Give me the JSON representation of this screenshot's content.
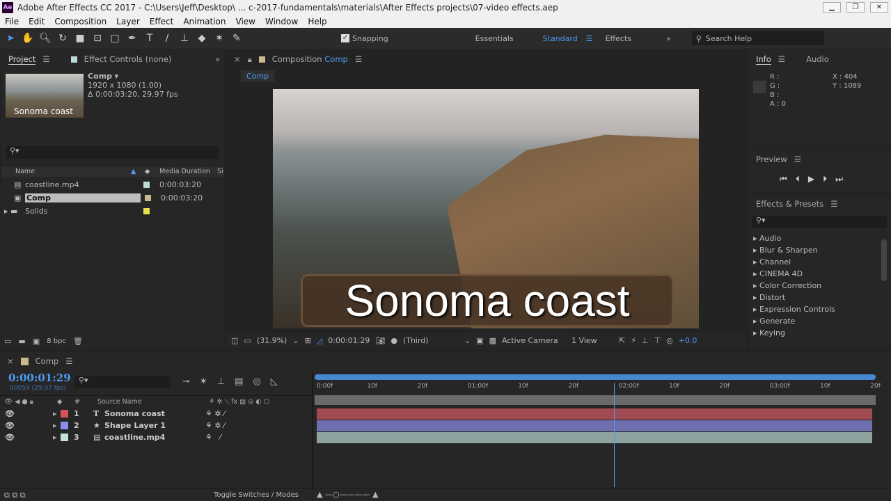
{
  "window": {
    "title": "Adobe After Effects CC 2017 - C:\\Users\\Jeff\\Desktop\\ ... c-2017-fundamentals\\materials\\After Effects projects\\07-video effects.aep",
    "logo": "Ae"
  },
  "menu": [
    "File",
    "Edit",
    "Composition",
    "Layer",
    "Effect",
    "Animation",
    "View",
    "Window",
    "Help"
  ],
  "toolbar": {
    "snapping": "Snapping",
    "snapping_checked": true,
    "workspaces": [
      "Essentials",
      "Standard",
      "Effects"
    ],
    "active_workspace": "Standard",
    "search_help": "Search Help"
  },
  "project": {
    "tab": "Project",
    "effect_controls": "Effect Controls (none)",
    "thumb_label": "Sonoma coast",
    "comp_name": "Comp",
    "comp_size": "1920 x 1080 (1.00)",
    "comp_duration": "Δ 0:00:03:20, 29.97 fps",
    "columns": {
      "name": "Name",
      "duration": "Media Duration",
      "extra": "Si"
    },
    "items": [
      {
        "name": "coastline.mp4",
        "duration": "0:00:03:20",
        "color": "#b9dcd9"
      },
      {
        "name": "Comp",
        "duration": "0:00:03:20",
        "color": "#c8b98f"
      },
      {
        "name": "Solids",
        "duration": "",
        "color": "#e8e04c"
      }
    ],
    "bpc": "8 bpc"
  },
  "composition": {
    "tab_label": "Composition",
    "tab_name": "Comp",
    "sub_tab": "Comp",
    "overlay_text": "Sonoma coast",
    "footer": {
      "zoom": "(31.9%)",
      "time": "0:00:01:29",
      "resolution": "(Third)",
      "camera": "Active Camera",
      "views": "1 View",
      "exposure": "+0.0"
    }
  },
  "info": {
    "tab": "Info",
    "audio_tab": "Audio",
    "r": "R :",
    "g": "G :",
    "b": "B :",
    "a": "A : 0",
    "x": "X : 404",
    "y": "Y : 1089"
  },
  "preview": {
    "title": "Preview"
  },
  "effects": {
    "title": "Effects & Presets",
    "items": [
      "Audio",
      "Blur & Sharpen",
      "Channel",
      "CINEMA 4D",
      "Color Correction",
      "Distort",
      "Expression Controls",
      "Generate",
      "Keying"
    ]
  },
  "timeline": {
    "tab": "Comp",
    "timecode": "0:00:01:29",
    "frames": "00059 (29.97 fps)",
    "columns": {
      "num": "#",
      "source": "Source Name"
    },
    "layers": [
      {
        "num": "1",
        "icon": "T",
        "name": "Sonoma coast",
        "color": "#d9505a",
        "bar": "#a04a52"
      },
      {
        "num": "2",
        "icon": "★",
        "name": "Shape Layer 1",
        "color": "#8a8ff0",
        "bar": "#6e6fae"
      },
      {
        "num": "3",
        "icon": "▤",
        "name": "coastline.mp4",
        "color": "#bfe3da",
        "bar": "#8ea39f"
      }
    ],
    "ruler": [
      "0:00f",
      "10f",
      "20f",
      "01:00f",
      "10f",
      "20f",
      "02:00f",
      "10f",
      "20f",
      "03:00f",
      "10f",
      "20f"
    ],
    "playhead_seconds": 1.97,
    "footer": "Toggle Switches / Modes"
  }
}
